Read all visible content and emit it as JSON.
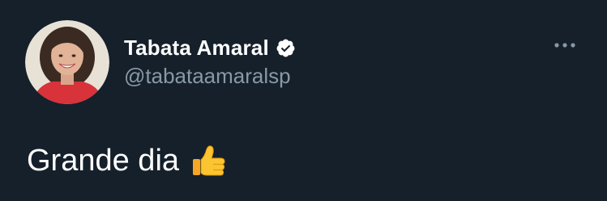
{
  "tweet": {
    "author": {
      "display_name": "Tabata Amaral",
      "handle": "@tabataamaralsp",
      "verified": true,
      "avatar_icon": "profile-photo"
    },
    "text": "Grande dia",
    "emoji": "thumbs-up-icon",
    "more_icon": "more-options-icon"
  },
  "colors": {
    "background": "#15202b",
    "primary_text": "#ffffff",
    "secondary_text": "#8899a6",
    "verified_badge": "#ffffff",
    "thumbs_up": "#fbbf24"
  }
}
